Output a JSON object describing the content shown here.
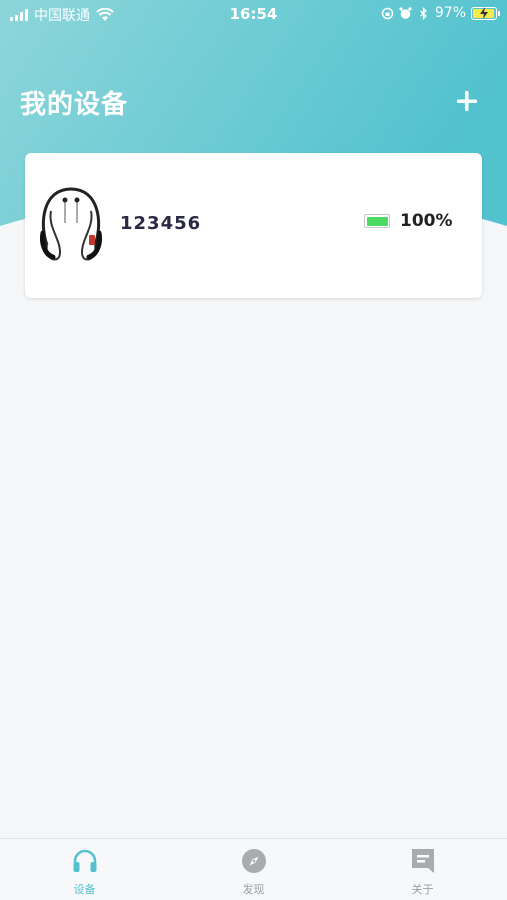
{
  "status_bar": {
    "carrier": "中国联通",
    "time": "16:54",
    "battery_percent": "97%",
    "battery_level": 0.97
  },
  "header": {
    "title": "我的设备",
    "add_icon": "plus-icon",
    "gradient_colors": [
      "#7fd3d8",
      "#55c3cf"
    ]
  },
  "devices": [
    {
      "name": "123456",
      "battery_percent": "100%",
      "battery_level": 1.0,
      "image": "neckband-earphones"
    }
  ],
  "tabs": [
    {
      "label": "设备",
      "icon": "headphones-icon",
      "active": true
    },
    {
      "label": "发现",
      "icon": "compass-icon",
      "active": false
    },
    {
      "label": "关于",
      "icon": "bookmark-icon",
      "active": false
    }
  ],
  "colors": {
    "accent": "#55c1cf",
    "battery_green": "#4cd964",
    "inactive": "#9a9ea3",
    "background": "#f4f6f8"
  }
}
